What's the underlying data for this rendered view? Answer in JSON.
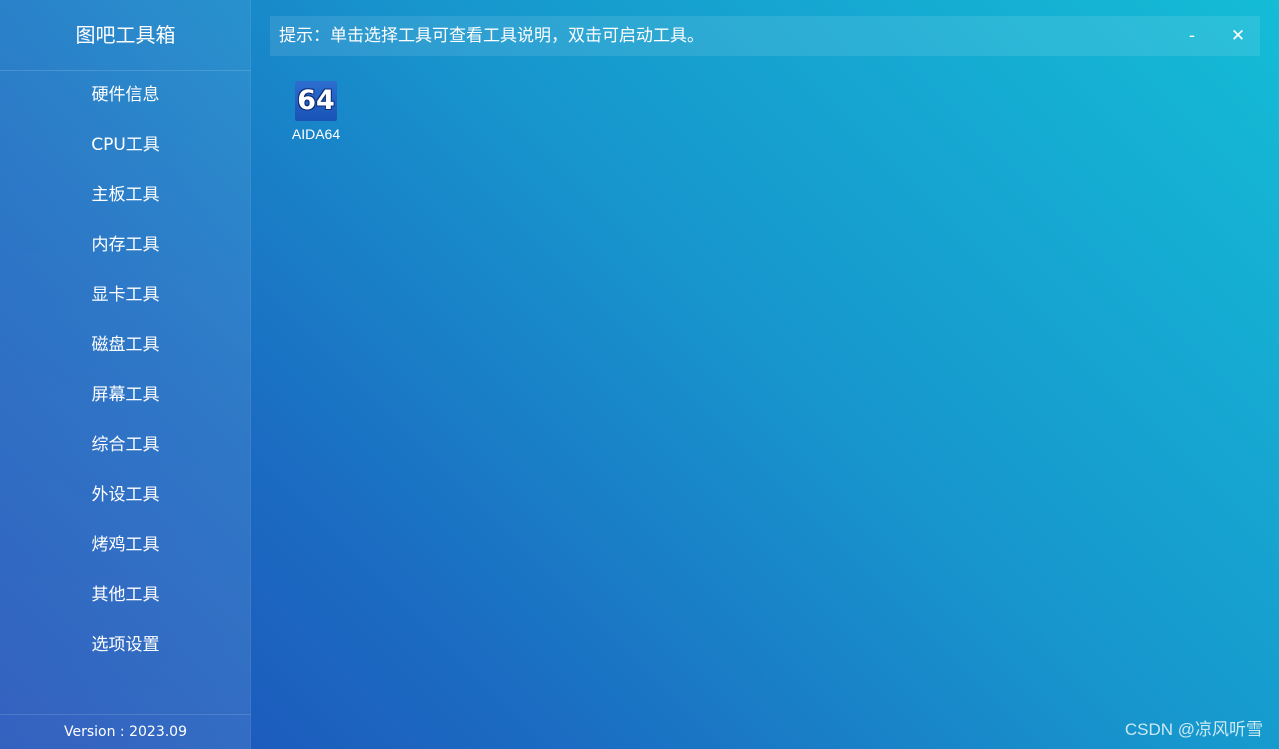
{
  "app": {
    "title": "图吧工具箱",
    "version": "Version : 2023.09"
  },
  "sidebar": {
    "items": [
      {
        "label": "硬件信息"
      },
      {
        "label": "CPU工具"
      },
      {
        "label": "主板工具"
      },
      {
        "label": "内存工具"
      },
      {
        "label": "显卡工具"
      },
      {
        "label": "磁盘工具"
      },
      {
        "label": "屏幕工具"
      },
      {
        "label": "综合工具"
      },
      {
        "label": "外设工具"
      },
      {
        "label": "烤鸡工具"
      },
      {
        "label": "其他工具"
      },
      {
        "label": "选项设置"
      }
    ]
  },
  "hint_bar": {
    "text": "提示：单击选择工具可查看工具说明，双击可启动工具。",
    "minimize": "-",
    "close": "✕"
  },
  "tools": [
    {
      "icon_text": "64",
      "label": "AIDA64",
      "icon": "aida64-icon"
    }
  ],
  "watermark": "CSDN @凉风听雪",
  "colors": {
    "background_start": "#1d4fb8",
    "background_end": "#14bcd6",
    "text": "#ffffff"
  }
}
